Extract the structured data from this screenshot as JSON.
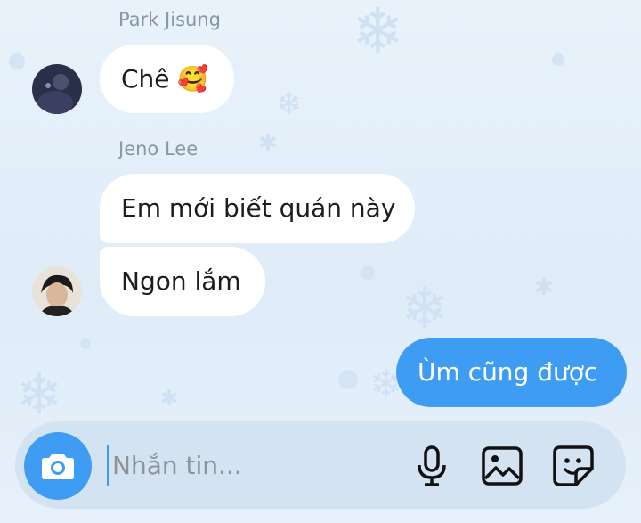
{
  "thread": {
    "groups": [
      {
        "sender": "Park Jisung",
        "messages": [
          "Chê 🥰"
        ]
      },
      {
        "sender": "Jeno Lee",
        "messages": [
          "Em mới biết quán này",
          "Ngon lắm"
        ]
      }
    ],
    "outgoing": [
      "Ùm cũng được"
    ]
  },
  "composer": {
    "placeholder": "Nhắn tin...",
    "camera_icon": "camera-icon",
    "mic_icon": "microphone-icon",
    "gallery_icon": "image-icon",
    "sticker_icon": "sticker-icon"
  },
  "colors": {
    "accent": "#3e9df2",
    "incoming_bubble": "#ffffff",
    "background": "#e3eef9",
    "composer_bg": "#d4e3f2"
  }
}
